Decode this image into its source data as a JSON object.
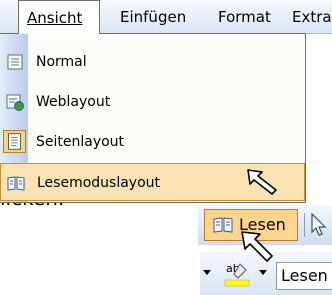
{
  "menubar": {
    "items": [
      {
        "label": "Ansicht",
        "active": true
      },
      {
        "label": "Einfügen",
        "active": false
      },
      {
        "label": "Format",
        "active": false
      },
      {
        "label": "Extra",
        "active": false
      }
    ]
  },
  "dropdown": {
    "items": [
      {
        "label": "Normal",
        "icon": "normal-view-icon"
      },
      {
        "label": "Weblayout",
        "icon": "web-layout-icon"
      },
      {
        "label": "Seitenlayout",
        "icon": "page-layout-icon",
        "checked": true
      },
      {
        "label": "Lesemoduslayout",
        "icon": "reading-layout-icon",
        "highlighted": true
      }
    ]
  },
  "page_text": "licken.",
  "toolbar": {
    "lesen_label": "Lesen",
    "style_field_value": "Lesen"
  },
  "colors": {
    "menu_highlight": "#fde3b4",
    "button_active": "#fdd58f",
    "toolbar_blue": "#cfdcf0"
  }
}
